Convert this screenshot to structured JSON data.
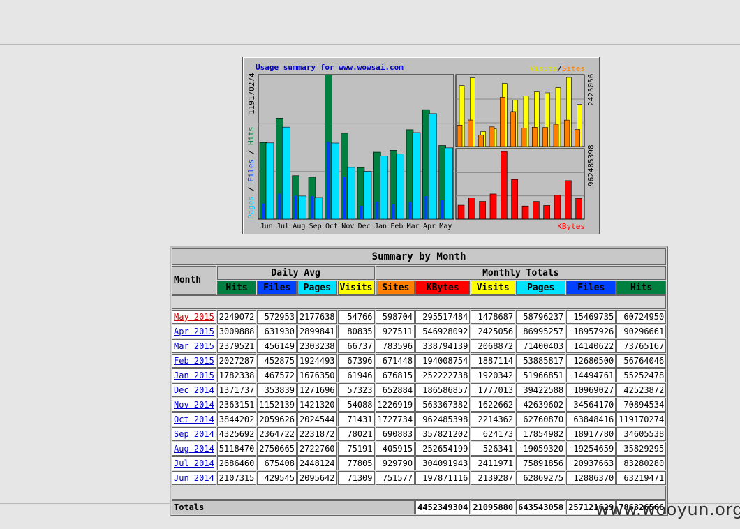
{
  "chart_data": {
    "type": "bar",
    "title": "Usage summary for www.wowsai.com",
    "categories": [
      "Jun",
      "Jul",
      "Aug",
      "Sep",
      "Oct",
      "Nov",
      "Dec",
      "Jan",
      "Feb",
      "Mar",
      "Apr",
      "May"
    ],
    "left_panel": {
      "ylabel_parts": [
        "Pages",
        "Files",
        "Hits"
      ],
      "ymax_label": "119170274",
      "ylim": [
        0,
        119170274
      ],
      "series": [
        {
          "name": "Hits",
          "color": "#008040",
          "values": [
            63219471,
            83280280,
            35829295,
            34605538,
            119170274,
            70894534,
            42523872,
            55252478,
            56764046,
            73765167,
            90296661,
            60724950
          ]
        },
        {
          "name": "Files",
          "color": "#0040ff",
          "values": [
            12886370,
            20937663,
            19254659,
            18917780,
            63848416,
            34564170,
            10969027,
            14494761,
            12680500,
            14140622,
            18957926,
            15469735
          ]
        },
        {
          "name": "Pages",
          "color": "#00e0ff",
          "values": [
            62869275,
            75891856,
            19059320,
            17854982,
            62760870,
            42639602,
            39422588,
            51966851,
            53885817,
            71400403,
            86995257,
            58796237
          ]
        }
      ]
    },
    "top_right_panel": {
      "legend_parts": [
        "Visits",
        "Sites"
      ],
      "ymax_label": "2425056",
      "ylim": [
        0,
        2425056
      ],
      "series": [
        {
          "name": "Visits",
          "color": "#ffff00",
          "values": [
            2139287,
            2411971,
            526341,
            624173,
            2214362,
            1622662,
            1777013,
            1920342,
            1887114,
            2068872,
            2425056,
            1478687
          ]
        },
        {
          "name": "Sites",
          "color": "#ff8000",
          "values": [
            751577,
            929790,
            405915,
            690883,
            1727734,
            1226919,
            652884,
            676815,
            671448,
            783596,
            927511,
            598704
          ]
        }
      ]
    },
    "bottom_right_panel": {
      "legend": "KBytes",
      "ymax_label": "962485398",
      "ylim": [
        0,
        962485398
      ],
      "series": [
        {
          "name": "KBytes",
          "color": "#ff0000",
          "values": [
            197871116,
            304091943,
            252654199,
            357821202,
            962485398,
            563367382,
            186586857,
            252222738,
            194008754,
            338794139,
            546928092,
            295517484
          ]
        }
      ]
    }
  },
  "table": {
    "title": "Summary by Month",
    "month_header": "Month",
    "daily_avg_header": "Daily Avg",
    "monthly_totals_header": "Monthly Totals",
    "columns": [
      {
        "label": "Hits",
        "bg": "#008040"
      },
      {
        "label": "Files",
        "bg": "#0040ff"
      },
      {
        "label": "Pages",
        "bg": "#00e0ff"
      },
      {
        "label": "Visits",
        "bg": "#ffff00"
      },
      {
        "label": "Sites",
        "bg": "#ff8000"
      },
      {
        "label": "KBytes",
        "bg": "#ff0000"
      },
      {
        "label": "Visits",
        "bg": "#ffff00"
      },
      {
        "label": "Pages",
        "bg": "#00e0ff"
      },
      {
        "label": "Files",
        "bg": "#0040ff"
      },
      {
        "label": "Hits",
        "bg": "#008040"
      }
    ],
    "rows": [
      {
        "month": "May 2015",
        "current": true,
        "values": [
          "2249072",
          "572953",
          "2177638",
          "54766",
          "598704",
          "295517484",
          "1478687",
          "58796237",
          "15469735",
          "60724950"
        ]
      },
      {
        "month": "Apr 2015",
        "values": [
          "3009888",
          "631930",
          "2899841",
          "80835",
          "927511",
          "546928092",
          "2425056",
          "86995257",
          "18957926",
          "90296661"
        ]
      },
      {
        "month": "Mar 2015",
        "values": [
          "2379521",
          "456149",
          "2303238",
          "66737",
          "783596",
          "338794139",
          "2068872",
          "71400403",
          "14140622",
          "73765167"
        ]
      },
      {
        "month": "Feb 2015",
        "values": [
          "2027287",
          "452875",
          "1924493",
          "67396",
          "671448",
          "194008754",
          "1887114",
          "53885817",
          "12680500",
          "56764046"
        ]
      },
      {
        "month": "Jan 2015",
        "values": [
          "1782338",
          "467572",
          "1676350",
          "61946",
          "676815",
          "252222738",
          "1920342",
          "51966851",
          "14494761",
          "55252478"
        ]
      },
      {
        "month": "Dec 2014",
        "values": [
          "1371737",
          "353839",
          "1271696",
          "57323",
          "652884",
          "186586857",
          "1777013",
          "39422588",
          "10969027",
          "42523872"
        ]
      },
      {
        "month": "Nov 2014",
        "values": [
          "2363151",
          "1152139",
          "1421320",
          "54088",
          "1226919",
          "563367382",
          "1622662",
          "42639602",
          "34564170",
          "70894534"
        ]
      },
      {
        "month": "Oct 2014",
        "values": [
          "3844202",
          "2059626",
          "2024544",
          "71431",
          "1727734",
          "962485398",
          "2214362",
          "62760870",
          "63848416",
          "119170274"
        ]
      },
      {
        "month": "Sep 2014",
        "values": [
          "4325692",
          "2364722",
          "2231872",
          "78021",
          "690883",
          "357821202",
          "624173",
          "17854982",
          "18917780",
          "34605538"
        ]
      },
      {
        "month": "Aug 2014",
        "values": [
          "5118470",
          "2750665",
          "2722760",
          "75191",
          "405915",
          "252654199",
          "526341",
          "19059320",
          "19254659",
          "35829295"
        ]
      },
      {
        "month": "Jul 2014",
        "values": [
          "2686460",
          "675408",
          "2448124",
          "77805",
          "929790",
          "304091943",
          "2411971",
          "75891856",
          "20937663",
          "83280280"
        ]
      },
      {
        "month": "Jun 2014",
        "values": [
          "2107315",
          "429545",
          "2095642",
          "71309",
          "751577",
          "197871116",
          "2139287",
          "62869275",
          "12886370",
          "63219471"
        ]
      }
    ],
    "totals_label": "Totals",
    "totals": [
      "4452349304",
      "21095880",
      "643543058",
      "257121629",
      "786326566"
    ]
  },
  "watermark": "www.wooyun.org"
}
